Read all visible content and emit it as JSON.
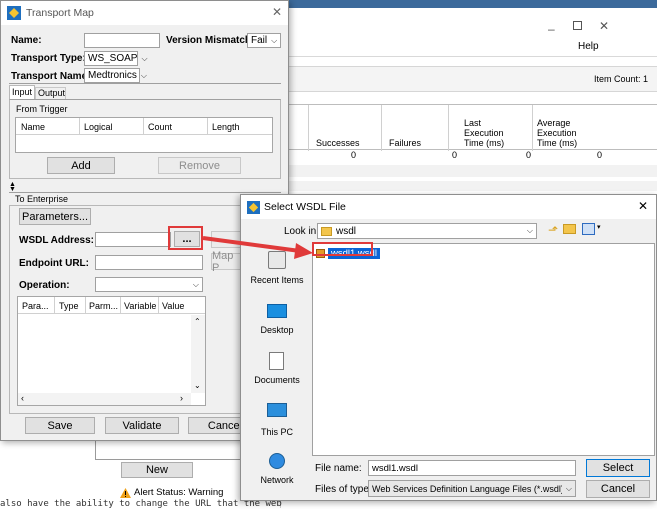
{
  "background_window": {
    "help_menu": "Help",
    "item_count": "Item Count: 1",
    "columns": [
      "Successes",
      "Failures",
      "Last Execution Time (ms)",
      "Average Execution Time (ms)"
    ],
    "col_last_lines": [
      "Last",
      "Execution",
      "Time (ms)"
    ],
    "col_avg_lines": [
      "Average",
      "Execution",
      "Time (ms)"
    ],
    "row_values": [
      "0",
      "0",
      "0",
      "0"
    ],
    "new_button": "New",
    "alert_status": "Alert Status: Warning",
    "bottom_text": "also have the ability to change the URL that the web"
  },
  "transport_map": {
    "title": "Transport Map",
    "name_label": "Name:",
    "name_value": "",
    "version_mismatch_label": "Version Mismatch:",
    "version_mismatch_value": "Fail",
    "transport_type_label": "Transport Type:",
    "transport_type_value": "WS_SOAP",
    "transport_name_label": "Transport Name:",
    "transport_name_value": "Medtronics",
    "tabs": [
      "Input",
      "Output"
    ],
    "from_trigger_label": "From Trigger",
    "trigger_columns": [
      "Name",
      "Logical",
      "Count",
      "Length"
    ],
    "add_button": "Add",
    "remove_button": "Remove",
    "to_enterprise_label": "To Enterprise",
    "parameters_button": "Parameters...",
    "wsdl_label": "WSDL Address:",
    "browse_button": "...",
    "endpoint_label": "Endpoint URL:",
    "operation_label": "Operation:",
    "map_partial": "Map P",
    "param_columns": [
      "Para...",
      "Type",
      "Parm...",
      "Variable",
      "Value"
    ],
    "save_button": "Save",
    "validate_button": "Validate",
    "cancel_button": "Cancel"
  },
  "select_wsdl": {
    "title": "Select WSDL File",
    "look_in_label": "Look in:",
    "look_in_value": "wsdl",
    "file_name_in_list": "wsdl1.wsdl",
    "sidebar": [
      "Recent Items",
      "Desktop",
      "Documents",
      "This PC",
      "Network"
    ],
    "file_name_label": "File name:",
    "file_name_value": "wsdl1.wsdl",
    "files_of_type_label": "Files of type:",
    "files_of_type_value": "Web Services Definition Language Files (*.wsdl)",
    "select_button": "Select",
    "cancel_button": "Cancel",
    "close_glyph": "✕"
  },
  "colors": {
    "highlight_red": "#e03a3a",
    "selection_blue": "#0a64d6",
    "titlebar_blue": "#3c6a9b"
  }
}
